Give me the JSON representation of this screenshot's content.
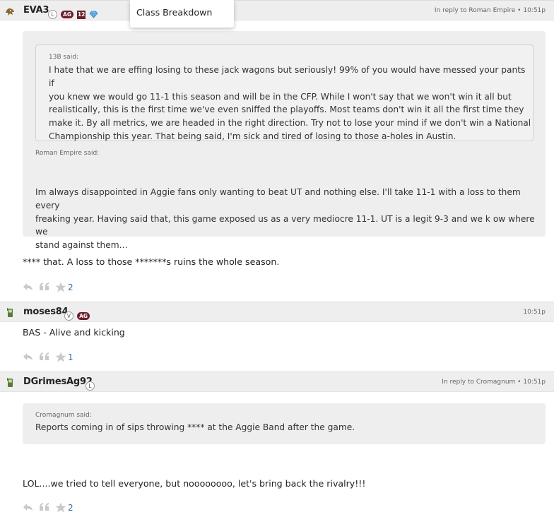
{
  "popup": {
    "label": "Class Breakdown"
  },
  "posts": [
    {
      "username": "EVA3",
      "badges": [
        "L",
        "AG",
        "12"
      ],
      "reply_meta": "In reply to Roman Empire • 10:51p",
      "nested_quote": {
        "author": "13B said:",
        "lines": [
          "I hate that we are effing losing to these jack wagons but seriously! 99% of you would have messed your pants if",
          "you knew we would go 11-1 this season and will be in the CFP. While I won't say that we won't win it all but",
          "realistically, this is the first time we've even sniffed the playoffs. Most teams don't win it all the first time they",
          "make it. By all metrics, we are headed in the right direction. Try not to lose your mind if we don't win a National",
          "Championship this year. That being said, I'm sick and tired of losing to those a-holes in Austin."
        ]
      },
      "quote": {
        "author": "Roman Empire said:",
        "lines": [
          "Im always disappointed in Aggie fans only wanting to beat UT and nothing else. I'll take 11-1 with a loss to them every",
          "freaking year. Having said that, this game exposed us as a very mediocre 11-1. UT is a legit 9-3 and we k ow where we",
          "stand against them…"
        ]
      },
      "body": "**** that. A loss to those *******s ruins the whole season.",
      "star_count": "2"
    },
    {
      "username": "moses84",
      "badges": [
        "V",
        "AG"
      ],
      "reply_meta": "10:51p",
      "body": "BAS - Alive and kicking",
      "star_count": "1"
    },
    {
      "username": "DGrimesAg92",
      "badges": [
        "L"
      ],
      "reply_meta": "In reply to Cromagnum • 10:51p",
      "quote": {
        "author": "Cromagnum said:",
        "lines": [
          "Reports coming in of sips throwing **** at the Aggie Band after the game."
        ]
      },
      "body": "LOL....we tried to tell everyone, but noooooooo, let's bring back the rivalry!!!",
      "star_count": "2"
    }
  ],
  "icons": [
    "reply-icon",
    "quote-icon",
    "star-icon",
    "phone-icon",
    "mascot-icon"
  ],
  "colors": {
    "accent_maroon": "#6b1e2b",
    "link_blue": "#3b6aa0",
    "header_gray": "#eeeeee"
  }
}
